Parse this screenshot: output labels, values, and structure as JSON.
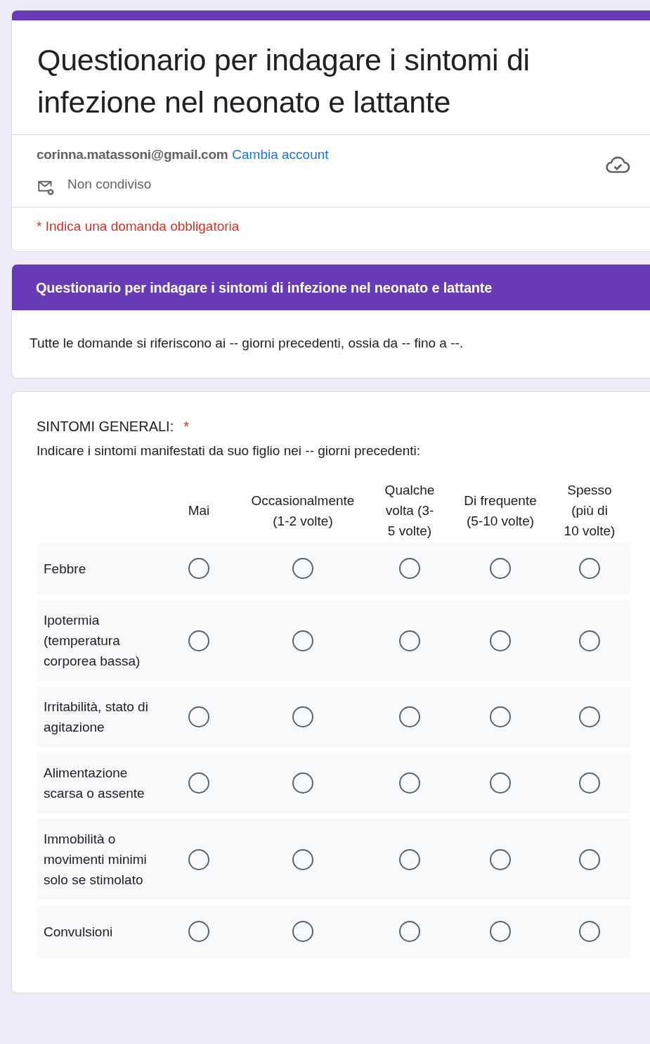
{
  "form": {
    "title": "Questionario per indagare i sintomi di infezione nel neonato e lattante",
    "account": {
      "email": "corinna.matassoni@gmail.com",
      "switch_link": "Cambia account",
      "sharing": "Non condiviso"
    },
    "required_note": "* Indica una domanda obbligatoria"
  },
  "section": {
    "title": "Questionario per indagare i sintomi di infezione nel neonato e lattante",
    "description": "Tutte le domande si riferiscono ai -- giorni precedenti, ossia da --  fino a --."
  },
  "question": {
    "title": "SINTOMI GENERALI:",
    "required_mark": "*",
    "description": "Indicare i sintomi manifestati da suo figlio nei -- giorni precedenti:",
    "columns": [
      "Mai",
      "Occasionalmente (1-2 volte)",
      "Qualche volta (3-5 volte)",
      "Di frequente (5-10 volte)",
      "Spesso (più di 10 volte)"
    ],
    "rows": [
      {
        "label": "Febbre",
        "options": [
          {
            "selected": false
          },
          {
            "selected": false
          },
          {
            "selected": false
          },
          {
            "selected": false
          },
          {
            "selected": false
          }
        ]
      },
      {
        "label": "Ipotermia (temperatura corporea bassa)",
        "options": [
          {
            "selected": false
          },
          {
            "selected": false
          },
          {
            "selected": false
          },
          {
            "selected": false
          },
          {
            "selected": false
          }
        ]
      },
      {
        "label": "Irritabilità, stato di agitazione",
        "options": [
          {
            "selected": false
          },
          {
            "selected": false
          },
          {
            "selected": false
          },
          {
            "selected": false
          },
          {
            "selected": false
          }
        ]
      },
      {
        "label": "Alimentazione scarsa o assente",
        "options": [
          {
            "selected": false
          },
          {
            "selected": false
          },
          {
            "selected": false
          },
          {
            "selected": false
          },
          {
            "selected": false
          }
        ]
      },
      {
        "label": "Immobilità o movimenti minimi solo se stimolato",
        "options": [
          {
            "selected": false
          },
          {
            "selected": false
          },
          {
            "selected": false
          },
          {
            "selected": false
          },
          {
            "selected": false
          }
        ]
      },
      {
        "label": "Convulsioni",
        "options": [
          {
            "selected": false
          },
          {
            "selected": false
          },
          {
            "selected": false
          },
          {
            "selected": false
          },
          {
            "selected": false
          }
        ]
      }
    ]
  }
}
